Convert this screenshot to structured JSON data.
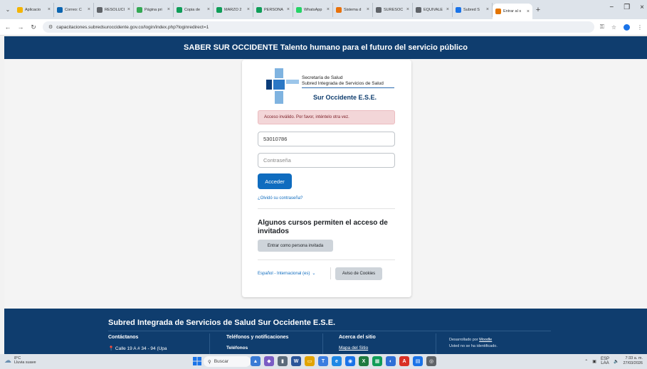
{
  "browser": {
    "tabs": [
      {
        "label": "Aplicacio",
        "color": "#f4b400"
      },
      {
        "label": "Correo: C",
        "color": "#0a64b0"
      },
      {
        "label": "RESOLUCI",
        "color": "#5f6368"
      },
      {
        "label": "Página pri",
        "color": "#34a853"
      },
      {
        "label": "Copia de",
        "color": "#0f9d58"
      },
      {
        "label": "MARZO 2",
        "color": "#0f9d58"
      },
      {
        "label": "PERSONA",
        "color": "#0f9d58"
      },
      {
        "label": "WhatsApp",
        "color": "#25d366"
      },
      {
        "label": "Sistema d",
        "color": "#e8710a"
      },
      {
        "label": "SURESOC",
        "color": "#5f6368"
      },
      {
        "label": "EQUIVALE",
        "color": "#5f6368"
      },
      {
        "label": "Subred S",
        "color": "#1a73e8"
      }
    ],
    "active_tab": {
      "label": "Entrar al s",
      "color": "#e37400"
    },
    "url": "capacitaciones.subredsuroccidente.gov.co/login/index.php?loginredirect=1"
  },
  "site": {
    "header_title": "SABER SUR OCCIDENTE Talento humano para el futuro del servicio público"
  },
  "logo": {
    "line1": "Secretaría de Salud",
    "line2": "Subred Integrada de Servicios de Salud",
    "line3": "Sur Occidente E.S.E."
  },
  "login": {
    "alert": "Acceso inválido. Por favor, inténtelo otra vez.",
    "username_value": "53010786",
    "password_placeholder": "Contraseña",
    "submit_label": "Acceder",
    "forgot_label": "¿Olvidó su contraseña?",
    "guest_heading": "Algunos cursos permiten el acceso de invitados",
    "guest_button": "Entrar como persona invitada",
    "language": "Español - Internacional (es)",
    "cookies_button": "Aviso de Cookies"
  },
  "footer": {
    "title": "Subred Integrada de Servicios de Salud Sur Occidente E.S.E.",
    "col1_heading": "Contáctanos",
    "col1_sub": "Calle 19 A # 34 - 94 (Upa",
    "col2_heading": "Teléfonos y notificaciones",
    "col2_sub": "Teléfonos",
    "col3_heading": "Acerca del sitio",
    "col3_sub": "Mapa del Sitio",
    "moodle_prefix": "Desarrollado por",
    "moodle_link": "Moodle",
    "not_logged": "Usted no se ha identificado."
  },
  "taskbar": {
    "weather_temp": "8°C",
    "weather_desc": "Lluvia suave",
    "search_placeholder": "Buscar",
    "lang_top": "ESP",
    "lang_bottom": "LAA",
    "time": "7:33 a. m.",
    "date": "27/03/2026"
  }
}
